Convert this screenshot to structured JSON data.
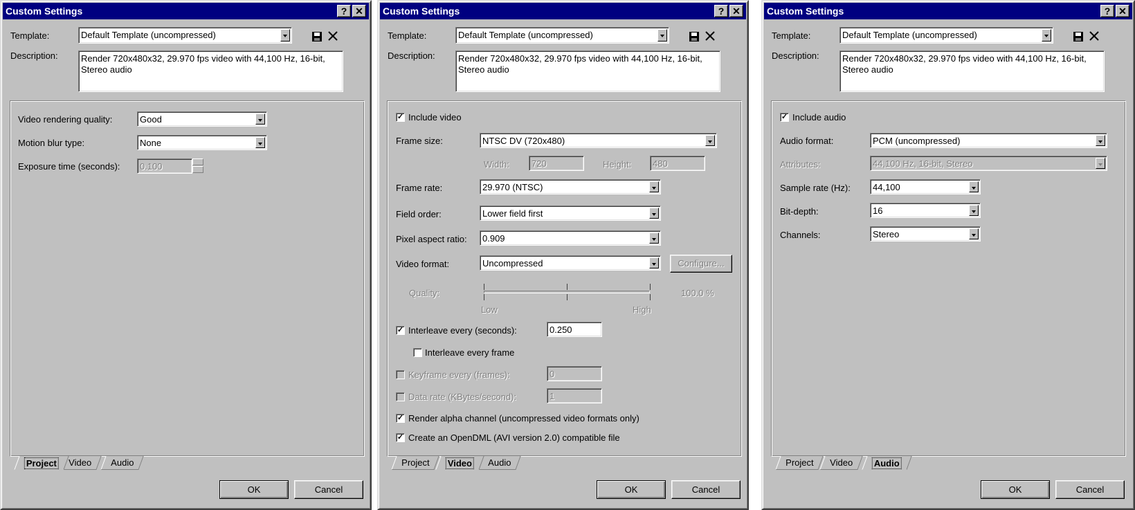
{
  "dialog_title": "Custom Settings",
  "help_glyph": "?",
  "close_glyph": "✕",
  "template": {
    "label": "Template:",
    "value": "Default Template (uncompressed)"
  },
  "description": {
    "label": "Description:",
    "text": "Render 720x480x32, 29.970 fps video with 44,100 Hz, 16-bit, Stereo audio"
  },
  "tabs": [
    "Project",
    "Video",
    "Audio"
  ],
  "buttons": {
    "ok": "OK",
    "cancel": "Cancel"
  },
  "project": {
    "video_quality_label": "Video rendering quality:",
    "video_quality_value": "Good",
    "motion_blur_label": "Motion blur type:",
    "motion_blur_value": "None",
    "exposure_label": "Exposure time (seconds):",
    "exposure_value": "0.100"
  },
  "video": {
    "include_video_label": "Include video",
    "include_video_checked": true,
    "frame_size_label": "Frame size:",
    "frame_size_value": "NTSC DV (720x480)",
    "width_label": "Width:",
    "width_value": "720",
    "height_label": "Height:",
    "height_value": "480",
    "frame_rate_label": "Frame rate:",
    "frame_rate_value": "29.970 (NTSC)",
    "field_order_label": "Field order:",
    "field_order_value": "Lower field first",
    "pixel_aspect_label": "Pixel aspect ratio:",
    "pixel_aspect_value": "0.909",
    "video_format_label": "Video format:",
    "video_format_value": "Uncompressed",
    "configure_label": "Configure...",
    "quality_label": "Quality:",
    "quality_low": "Low",
    "quality_high": "High",
    "quality_percent": "100.0 %",
    "quality_level": 1.0,
    "interleave_label": "Interleave every (seconds):",
    "interleave_value": "0.250",
    "interleave_frame_label": "Interleave every frame",
    "keyframe_label": "Keyframe every (frames):",
    "keyframe_value": "0",
    "data_rate_label": "Data rate (KBytes/second):",
    "data_rate_value": "1",
    "render_alpha_label": "Render alpha channel (uncompressed video formats only)",
    "opendml_label": "Create an OpenDML (AVI version 2.0) compatible file",
    "check_mark": "✓"
  },
  "audio": {
    "include_audio_label": "Include audio",
    "audio_format_label": "Audio format:",
    "audio_format_value": "PCM (uncompressed)",
    "attributes_label": "Attributes:",
    "attributes_value": "44,100 Hz, 16-bit, Stereo",
    "sample_rate_label": "Sample rate (Hz):",
    "sample_rate_value": "44,100",
    "bit_depth_label": "Bit-depth:",
    "bit_depth_value": "16",
    "channels_label": "Channels:",
    "channels_value": "Stereo"
  }
}
